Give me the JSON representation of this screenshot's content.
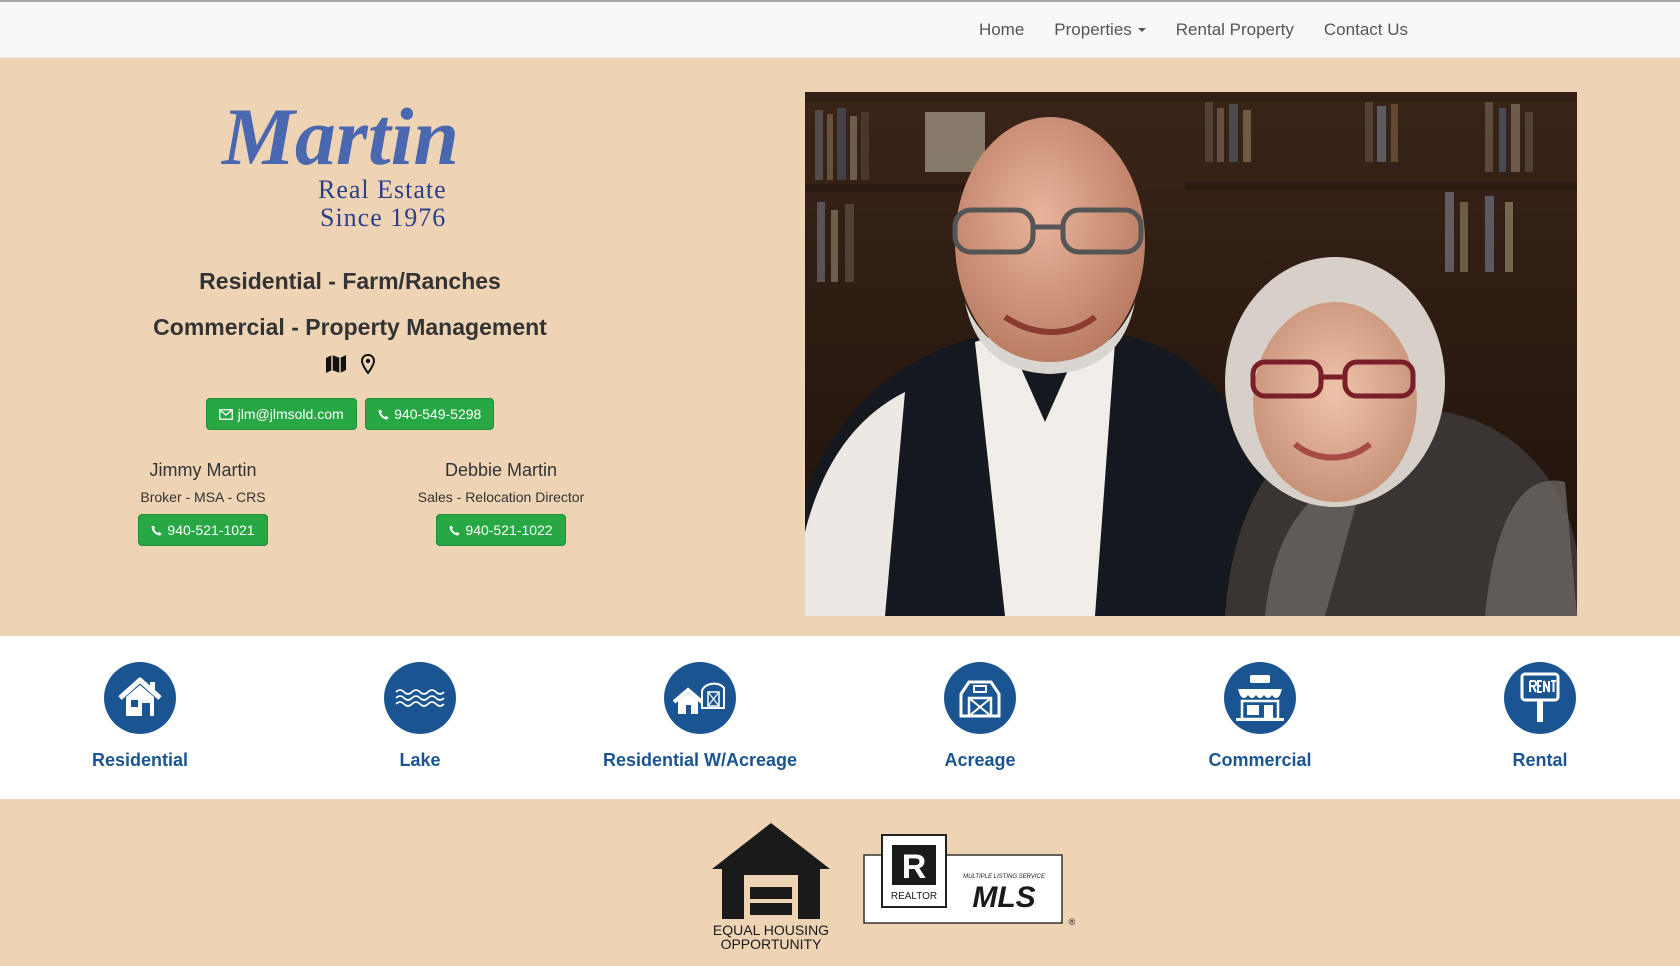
{
  "nav": {
    "home": "Home",
    "properties": "Properties",
    "rental_property": "Rental Property",
    "contact_us": "Contact Us"
  },
  "hero": {
    "logo": {
      "brand": "Martin",
      "line1": "Real Estate",
      "line2": "Since 1976"
    },
    "tagline1": "Residential - Farm/Ranches",
    "tagline2": "Commercial - Property Management",
    "email": "jlm@jlmsold.com",
    "phone": "940-549-5298",
    "agents": [
      {
        "name": "Jimmy Martin",
        "title": "Broker - MSA - CRS",
        "phone": "940-521-1021"
      },
      {
        "name": "Debbie Martin",
        "title": "Sales - Relocation Director",
        "phone": "940-521-1022"
      }
    ]
  },
  "categories": [
    {
      "label": "Residential",
      "icon": "house-icon"
    },
    {
      "label": "Lake",
      "icon": "waves-icon"
    },
    {
      "label": "Residential W/Acreage",
      "icon": "house-barn-icon"
    },
    {
      "label": "Acreage",
      "icon": "barn-icon"
    },
    {
      "label": "Commercial",
      "icon": "shop-icon"
    },
    {
      "label": "Rental",
      "icon": "rent-sign-icon"
    }
  ],
  "footer": {
    "eho_line1": "EQUAL HOUSING",
    "eho_line2": "OPPORTUNITY",
    "realtor": "REALTOR",
    "mls_small": "MULTIPLE LISTING SERVICE",
    "mls": "MLS"
  },
  "colors": {
    "accent": "#1a5591",
    "button": "#28a745",
    "background": "#efd3b5"
  }
}
